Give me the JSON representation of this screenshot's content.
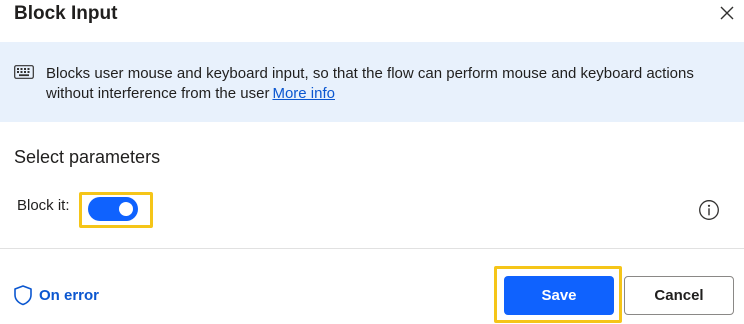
{
  "dialog": {
    "title": "Block Input",
    "close_icon": "close-icon"
  },
  "info": {
    "icon": "keyboard-icon",
    "text": "Blocks user mouse and keyboard input, so that the flow can perform mouse and keyboard actions without interference from the user",
    "link_label": "More info"
  },
  "parameters": {
    "section_title": "Select parameters",
    "block_it": {
      "label": "Block it:",
      "value": true,
      "info_icon": "info-icon"
    }
  },
  "footer": {
    "on_error_icon": "shield-icon",
    "on_error_label": "On error",
    "save_label": "Save",
    "cancel_label": "Cancel"
  },
  "colors": {
    "accent": "#0f62fe",
    "link": "#0b57d0",
    "banner_bg": "#e8f1fc",
    "highlight": "#f5c518"
  }
}
